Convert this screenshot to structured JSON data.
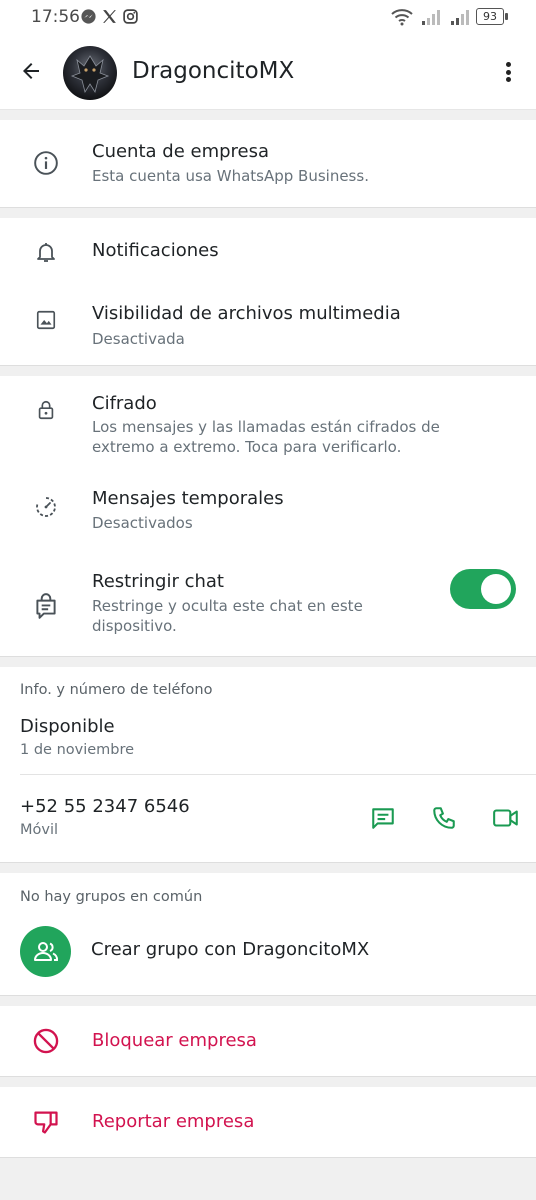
{
  "status_bar": {
    "time": "17:56",
    "battery": "93",
    "app_icons": [
      "messenger-icon",
      "x-icon",
      "instagram-icon"
    ]
  },
  "header": {
    "contact_name": "DragoncitoMX"
  },
  "business_card": {
    "title": "Cuenta de empresa",
    "subtitle": "Esta cuenta usa WhatsApp Business."
  },
  "settings": {
    "notifications": {
      "title": "Notificaciones"
    },
    "media_visibility": {
      "title": "Visibilidad de archivos multimedia",
      "subtitle": "Desactivada"
    }
  },
  "privacy": {
    "encryption": {
      "title": "Cifrado",
      "subtitle": "Los mensajes y las llamadas están cifrados de extremo a extremo. Toca para verificarlo."
    },
    "disappearing": {
      "title": "Mensajes temporales",
      "subtitle": "Desactivados"
    },
    "lock_chat": {
      "title": "Restringir chat",
      "subtitle": "Restringe y oculta este chat en este dispositivo.",
      "enabled": true
    }
  },
  "info": {
    "section_label": "Info. y número de teléfono",
    "about": "Disponible",
    "about_date": "1 de noviembre",
    "phone": "+52 55 2347 6546",
    "phone_type": "Móvil"
  },
  "groups": {
    "section_label": "No hay grupos en común",
    "create_group": "Crear grupo con DragoncitoMX"
  },
  "block": {
    "label": "Bloquear empresa"
  },
  "report": {
    "label": "Reportar empresa"
  },
  "colors": {
    "accent": "#21a55c",
    "danger": "#d2134f",
    "background": "#f0f0f0"
  }
}
